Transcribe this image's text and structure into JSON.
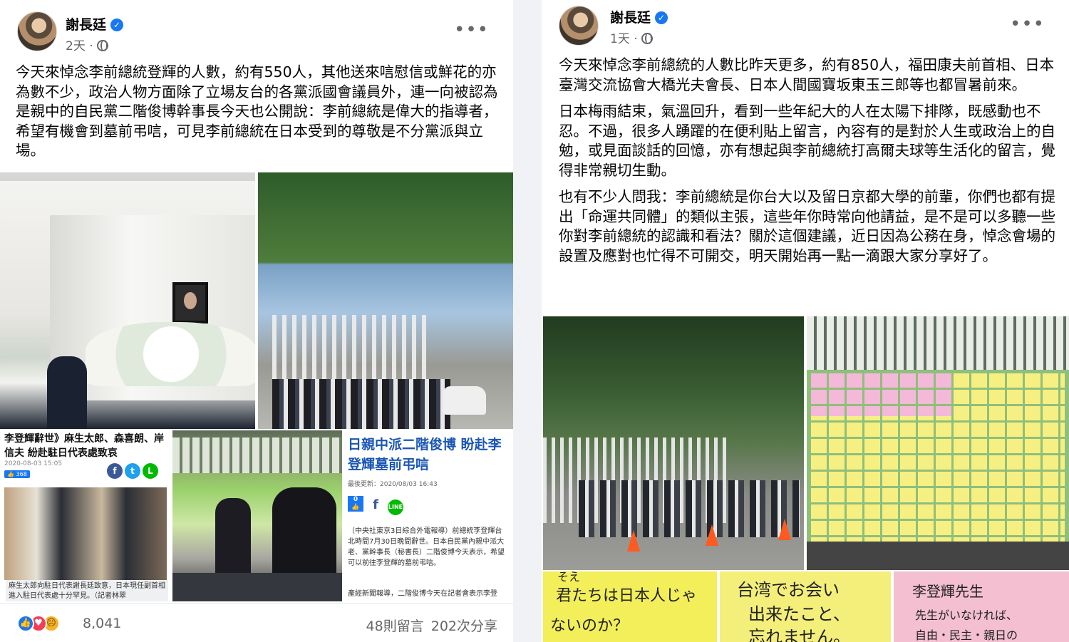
{
  "left_post": {
    "author": "謝長廷",
    "time": "2天",
    "more": "•••",
    "text": "今天來悼念李前總統登輝的人數，約有550人，其他送來唁慰信或鮮花的亦為數不少，政治人物方面除了立場友台的各黨派國會議員外，連一向被認為是親中的自民黨二階俊博幹事長今天也公開說：李前總統是偉大的指導者，希望有機會到墓前弔唁，可見李前總統在日本受到的尊敬是不分黨派與立場。",
    "news1": {
      "headline": "李登輝辭世》麻生太郎、森喜朗、岸信夫 紛赴駐日代表處致哀",
      "date": "2020-08-03 15:05",
      "like_count": "368",
      "caption": "麻生太郎向駐日代表謝長廷致意，日本現任副首相進入駐日代表處十分罕見。（記者林翠"
    },
    "news3": {
      "headline": "日親中派二階俊博 盼赴李登輝墓前弔唁",
      "updated": "最後更新：2020/08/03 16:43",
      "like_count": "0",
      "body": "（中央社東京3日綜合外電報導）前總統李登輝台北時間7月30日晚間辭世。日本自民黨內親中派大老、黨幹事長（秘書長）二階俊博今天表示，希望可以前往李登輝的墓前弔唁。",
      "body2": "產經新聞報導，二階俊博今天在記者會表示李登"
    },
    "reaction_count": "8,041",
    "comments": "48則留言",
    "shares": "202次分享"
  },
  "right_post": {
    "author": "謝長廷",
    "time": "1天",
    "more": "•••",
    "paragraphs": [
      "今天來悼念李前總統的人數比昨天更多，約有850人，福田康夫前首相、日本臺灣交流協會大橋光夫會長、日本人間國寶坂東玉三郎等也都冒暑前來。",
      "日本梅雨結束，氣溫回升，看到一些年紀大的人在太陽下排隊，既感動也不忍。不過，很多人踴躍的在便利貼上留言，內容有的是對於人生或政治上的自勉，或見面談話的回憶，亦有想起與李前總統打高爾夫球等生活化的留言，覺得非常親切生動。",
      "也有不少人問我：李前總統是你台大以及留日京都大學的前輩，你們也都有提出「命運共同體」的類似主張，這些年你時常向他請益，是不是可以多聽一些你對李前總統的認識和看法？關於這個建議，近日因為公務在身，悼念會場的設置及應對也忙得不可開交，明天開始再一點一滴跟大家分享好了。"
    ],
    "notes": {
      "n1": [
        "そえ",
        "君たちは日本人じゃ",
        "ないのか？"
      ],
      "n2": [
        "台湾でお会い",
        "出来たこと、",
        "忘れません。"
      ],
      "n3": [
        "李登輝先生",
        "先生がいなければ、",
        "自由・民主・親日の"
      ]
    }
  },
  "colors": {
    "facebook_blue": "#1877f2",
    "text": "#050505",
    "meta": "#65676b",
    "news_headline": "#1a56b3"
  },
  "icons": [
    "verified-badge-icon",
    "globe-icon",
    "more-options-icon",
    "like-reaction-icon",
    "love-reaction-icon",
    "sad-reaction-icon",
    "facebook-icon",
    "twitter-icon",
    "line-icon"
  ]
}
